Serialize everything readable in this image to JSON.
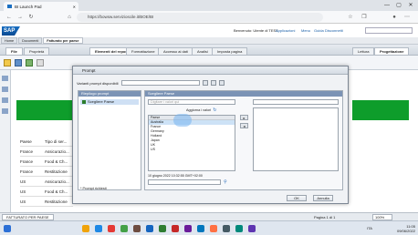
{
  "browser": {
    "tab_title": "BI Launch Pad",
    "url": "https://bowsw.servizioscile.it/BOE/BI",
    "window_controls": [
      "—",
      "▢",
      "✕"
    ]
  },
  "sap_header": {
    "logo": "SAP",
    "welcome": "Benvenuto: Utente di TEST",
    "menus": [
      "Applicazioni",
      "Menu",
      "Guida",
      "Disconnetti"
    ]
  },
  "breadcrumbs": [
    {
      "label": "Home",
      "active": false
    },
    {
      "label": "Documenti",
      "active": false
    },
    {
      "label": "Fatturato per paese",
      "active": true
    }
  ],
  "app_tabs": {
    "left": [
      "File",
      "Proprietà"
    ],
    "main": [
      "Elementi del report",
      "Formattazione",
      "Accesso ai dati",
      "Analisi",
      "Imposta pagina"
    ],
    "right": [
      "Lettura",
      "Progettazione"
    ]
  },
  "doc_bg": {
    "column_header": [
      "Paese",
      "Tipo di ser..."
    ],
    "rows": [
      [
        "France",
        "Assicurazio..."
      ],
      [
        "France",
        "Food & Ch..."
      ],
      [
        "France",
        "Restitazione"
      ],
      [
        "US",
        "Assicurazio..."
      ],
      [
        "US",
        "Food & Ch..."
      ],
      [
        "US",
        "Restitazione"
      ]
    ]
  },
  "status_bar": {
    "report_tab": "FATTURATO PER PAESE",
    "page_info": "Pagina 1 di 1",
    "zoom": "100%"
  },
  "dialog": {
    "title": "Prompt",
    "variants_label": "Varianti prompt disponibili",
    "prompt_panel_head": "Riepilogo prompt",
    "prompt_item": "Scegliere Paese",
    "value_panel_head": "Scegliere Paese",
    "type_placeholder": "Digitare i valori qui",
    "refresh_label": "Aggiorna i valori",
    "list_header": "Paese",
    "list_values": [
      "Australia",
      "France",
      "Germany",
      "Holland",
      "Japan",
      "UK",
      "US"
    ],
    "selected_value_index": 0,
    "last_update": "10 giugno 2022 10:32:55 GMT+02:00",
    "mandatory_note": "* Prompt richiesti",
    "ok_label": "OK",
    "cancel_label": "Annulla"
  },
  "taskbar": {
    "time": "11:05",
    "date": "09/06/2022",
    "lang": "ITA"
  }
}
